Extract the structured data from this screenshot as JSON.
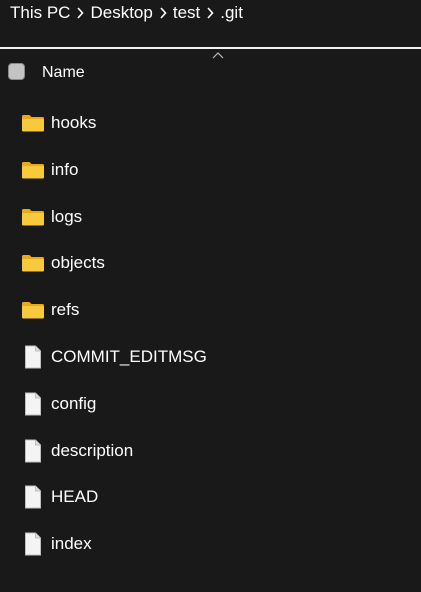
{
  "breadcrumb": {
    "items": [
      "This PC",
      "Desktop",
      "test",
      ".git"
    ]
  },
  "header": {
    "name_label": "Name"
  },
  "files": [
    {
      "name": "hooks",
      "type": "folder"
    },
    {
      "name": "info",
      "type": "folder"
    },
    {
      "name": "logs",
      "type": "folder"
    },
    {
      "name": "objects",
      "type": "folder"
    },
    {
      "name": "refs",
      "type": "folder"
    },
    {
      "name": "COMMIT_EDITMSG",
      "type": "file"
    },
    {
      "name": "config",
      "type": "file"
    },
    {
      "name": "description",
      "type": "file"
    },
    {
      "name": "HEAD",
      "type": "file"
    },
    {
      "name": "index",
      "type": "file"
    }
  ],
  "icons": {
    "folder": "folder-icon",
    "file": "file-icon",
    "separator": "chevron-right-icon",
    "sort": "chevron-up-icon"
  },
  "colors": {
    "background": "#191919",
    "text": "#ffffff",
    "folder": "#f8c33a",
    "file": "#f4f4f4"
  }
}
